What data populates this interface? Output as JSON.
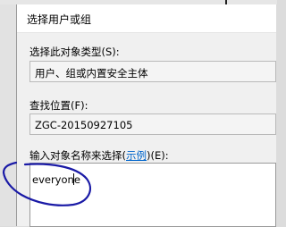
{
  "dialog": {
    "title": "选择用户或组",
    "object_type": {
      "label": "选择此对象类型(S):",
      "value": "用户、组或内置安全主体"
    },
    "location": {
      "label": "查找位置(F):",
      "value": "ZGC-20150927105"
    },
    "object_names": {
      "label_prefix": "输入对象名称来选择(",
      "examples_link": "示例",
      "label_suffix": ")(E):",
      "value": "everyone"
    }
  },
  "annotation": {
    "stroke_color": "#1a1aa6",
    "shape": "hand-drawn-circle"
  }
}
